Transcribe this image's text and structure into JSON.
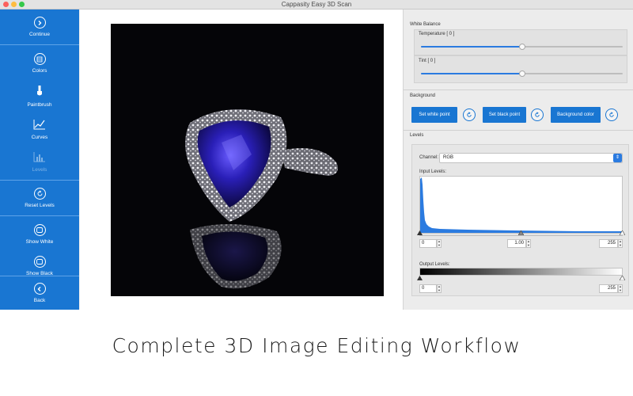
{
  "window": {
    "title": "Cappasity Easy 3D Scan"
  },
  "sidebar": {
    "items": [
      {
        "label": "Continue",
        "icon": "chevron-right-circle-icon",
        "enabled": true
      },
      {
        "label": "Colors",
        "icon": "colors-grid-icon",
        "enabled": true
      },
      {
        "label": "Paintbrush",
        "icon": "paintbrush-icon",
        "enabled": true
      },
      {
        "label": "Curves",
        "icon": "curves-icon",
        "enabled": true
      },
      {
        "label": "Levels",
        "icon": "levels-histogram-icon",
        "enabled": false
      },
      {
        "label": "Reset Levels",
        "icon": "reset-icon",
        "enabled": true
      },
      {
        "label": "Show White",
        "icon": "show-white-icon",
        "enabled": true
      },
      {
        "label": "Show Black",
        "icon": "show-black-icon",
        "enabled": true
      },
      {
        "label": "Back",
        "icon": "chevron-left-circle-icon",
        "enabled": true
      }
    ]
  },
  "white_balance": {
    "title": "White Balance",
    "temperature": {
      "label": "Temperature [ 0 ]",
      "value": 0,
      "position": 0.5
    },
    "tint": {
      "label": "Tint [ 0 ]",
      "value": 0,
      "position": 0.5
    }
  },
  "background": {
    "title": "Background",
    "buttons": [
      "Set white point",
      "Set black point",
      "Background color"
    ]
  },
  "levels": {
    "title": "Levels",
    "channel_label": "Channel:",
    "channel_value": "RGB",
    "input_label": "Input Levels:",
    "input_black": "0",
    "input_gamma": "1.00",
    "input_white": "255",
    "output_label": "Output Levels:",
    "output_black": "0",
    "output_white": "255"
  },
  "caption": "Complete 3D Image Editing Workflow",
  "colors": {
    "accent": "#1976d2",
    "slider_fill": "#2b7be0"
  }
}
